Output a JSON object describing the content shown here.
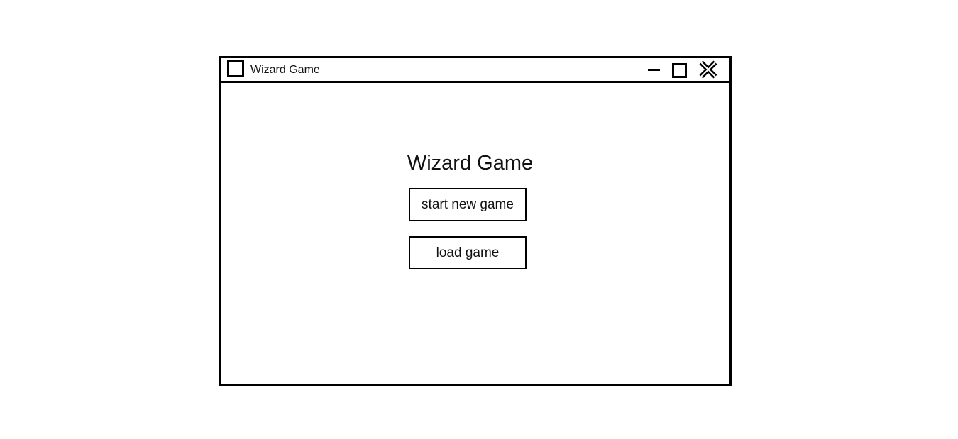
{
  "window": {
    "title": "Wizard Game",
    "controls": {
      "minimize_icon": "minimize-icon",
      "maximize_icon": "maximize-icon",
      "close_icon": "close-icon"
    }
  },
  "main": {
    "title": "Wizard Game",
    "buttons": [
      {
        "label": "start new game"
      },
      {
        "label": "load game"
      }
    ]
  }
}
